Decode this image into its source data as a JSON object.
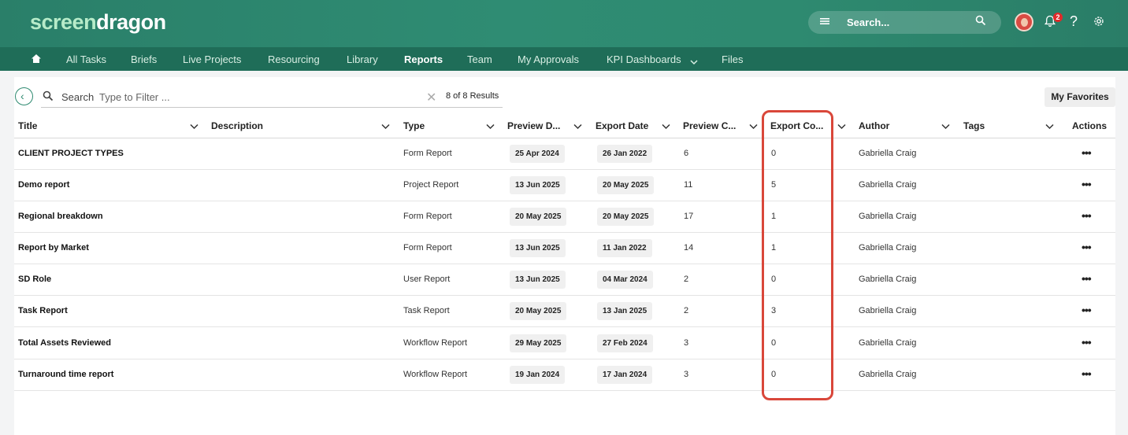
{
  "app": {
    "logo_part1": "screen",
    "logo_part2": "dragon"
  },
  "header": {
    "search_label": "Search...",
    "notification_count": "2",
    "help": "?"
  },
  "nav": {
    "items": [
      "All Tasks",
      "Briefs",
      "Live Projects",
      "Resourcing",
      "Library",
      "Reports",
      "Team",
      "My Approvals",
      "KPI Dashboards",
      "Files"
    ],
    "active": "Reports"
  },
  "toolbar": {
    "search_label": "Search",
    "filter_placeholder": "Type to Filter ...",
    "results": "8 of 8 Results",
    "favorites": "My Favorites"
  },
  "table": {
    "columns": [
      "Title",
      "Description",
      "Type",
      "Preview D...",
      "Export Date",
      "Preview C...",
      "Export Co...",
      "Author",
      "Tags",
      "Actions"
    ],
    "rows": [
      {
        "title": "CLIENT PROJECT TYPES",
        "description": "",
        "type": "Form Report",
        "preview_date": "25 Apr 2024",
        "export_date": "26 Jan 2022",
        "preview_count": "6",
        "export_count": "0",
        "author": "Gabriella Craig",
        "tags": ""
      },
      {
        "title": "Demo report",
        "description": "",
        "type": "Project Report",
        "preview_date": "13 Jun 2025",
        "export_date": "20 May 2025",
        "preview_count": "11",
        "export_count": "5",
        "author": "Gabriella Craig",
        "tags": ""
      },
      {
        "title": "Regional breakdown",
        "description": "",
        "type": "Form Report",
        "preview_date": "20 May 2025",
        "export_date": "20 May 2025",
        "preview_count": "17",
        "export_count": "1",
        "author": "Gabriella Craig",
        "tags": ""
      },
      {
        "title": "Report by Market",
        "description": "",
        "type": "Form Report",
        "preview_date": "13 Jun 2025",
        "export_date": "11 Jan 2022",
        "preview_count": "14",
        "export_count": "1",
        "author": "Gabriella Craig",
        "tags": ""
      },
      {
        "title": "SD Role",
        "description": "",
        "type": "User Report",
        "preview_date": "13 Jun 2025",
        "export_date": "04 Mar 2024",
        "preview_count": "2",
        "export_count": "0",
        "author": "Gabriella Craig",
        "tags": ""
      },
      {
        "title": "Task Report",
        "description": "",
        "type": "Task Report",
        "preview_date": "20 May 2025",
        "export_date": "13 Jan 2025",
        "preview_count": "2",
        "export_count": "3",
        "author": "Gabriella Craig",
        "tags": ""
      },
      {
        "title": "Total Assets Reviewed",
        "description": "",
        "type": "Workflow Report",
        "preview_date": "29 May 2025",
        "export_date": "27 Feb 2024",
        "preview_count": "3",
        "export_count": "0",
        "author": "Gabriella Craig",
        "tags": ""
      },
      {
        "title": "Turnaround time report",
        "description": "",
        "type": "Workflow Report",
        "preview_date": "19 Jan 2024",
        "export_date": "17 Jan 2024",
        "preview_count": "3",
        "export_count": "0",
        "author": "Gabriella Craig",
        "tags": ""
      }
    ],
    "actions_glyph": "•••"
  },
  "colors": {
    "brand": "#2e8a70",
    "nav": "#1f6d58",
    "highlight": "#d9473a",
    "badge": "#e02a2a"
  },
  "icons": [
    "home-icon",
    "hamburger-icon",
    "search-icon",
    "bell-icon",
    "help-icon",
    "gear-icon",
    "back-arrow-icon",
    "clear-icon",
    "chevron-down-icon",
    "more-icon"
  ]
}
